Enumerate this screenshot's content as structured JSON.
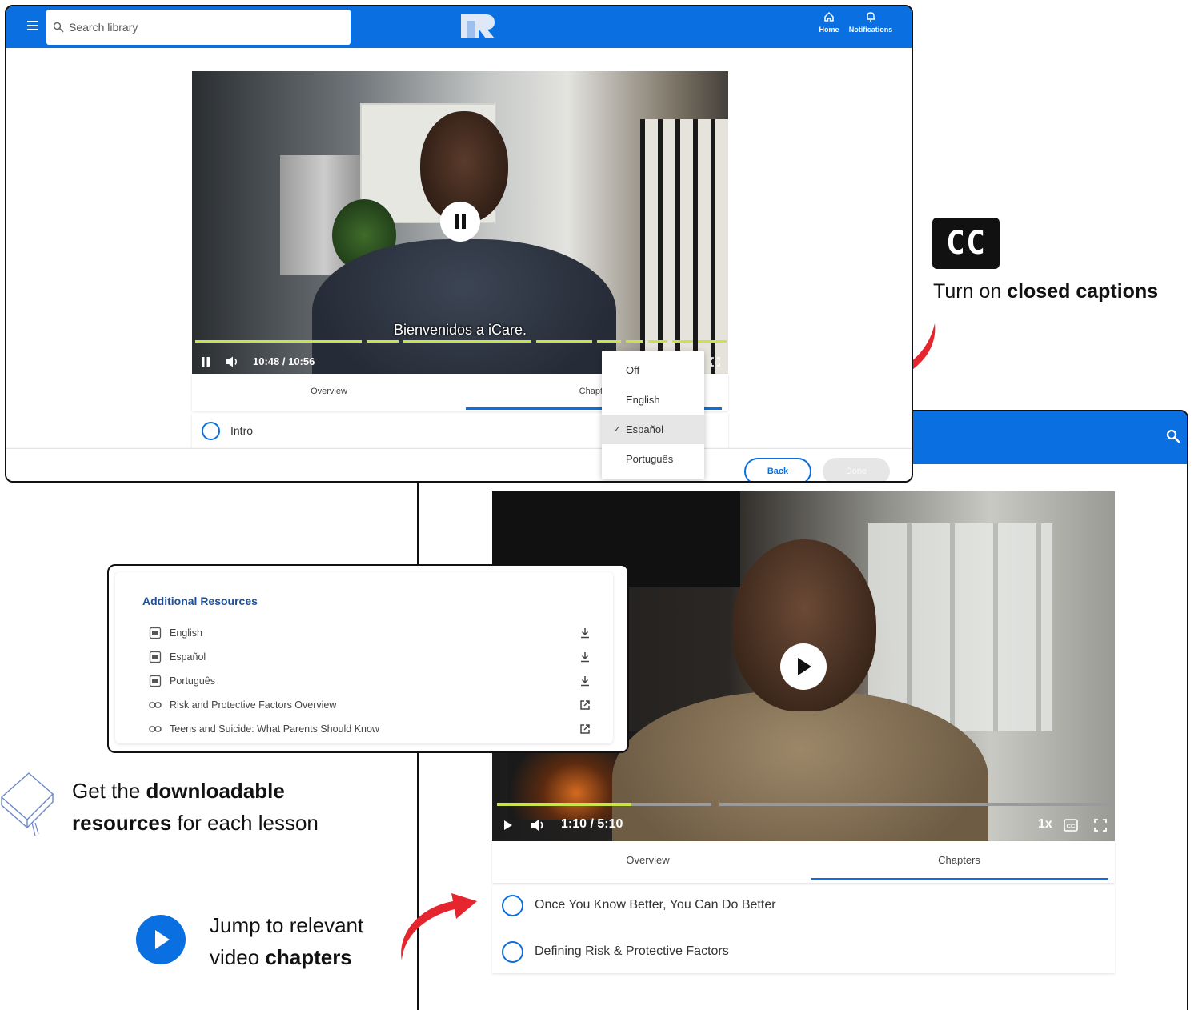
{
  "window1": {
    "search": {
      "placeholder": "Search library"
    },
    "nav": {
      "home_label": "Home",
      "notifications_label": "Notifications"
    },
    "video": {
      "subtitle": "Bienvenidos a iCare.",
      "time": "10:48 / 10:56"
    },
    "tabs": [
      {
        "label": "Overview"
      },
      {
        "label": "Chapters"
      }
    ],
    "captions_menu": {
      "options": [
        {
          "label": "Off"
        },
        {
          "label": "English"
        },
        {
          "label": "Español"
        },
        {
          "label": "Português"
        }
      ],
      "selected": "Español"
    },
    "chapters": [
      {
        "label": "Intro"
      }
    ],
    "footer": {
      "back_label": "Back",
      "done_label": "Done"
    }
  },
  "window2": {
    "video": {
      "time": "1:10 / 5:10",
      "speed": "1x",
      "progress_fraction": 0.23
    },
    "tabs": [
      {
        "label": "Overview"
      },
      {
        "label": "Chapters"
      }
    ],
    "active_tab": "Chapters",
    "chapters": [
      {
        "label": "Once You Know Better, You Can Do Better"
      },
      {
        "label": "Defining Risk & Protective Factors"
      }
    ]
  },
  "resources": {
    "title": "Additional Resources",
    "items": [
      {
        "label": "English",
        "icon": "pdf-icon",
        "action": "download-icon"
      },
      {
        "label": "Español",
        "icon": "pdf-icon",
        "action": "download-icon"
      },
      {
        "label": "Português",
        "icon": "pdf-icon",
        "action": "download-icon"
      },
      {
        "label": "Risk and Protective Factors Overview",
        "icon": "link-icon",
        "action": "external-link-icon"
      },
      {
        "label": "Teens and Suicide: What Parents Should Know",
        "icon": "link-icon",
        "action": "external-link-icon"
      }
    ]
  },
  "annotations": {
    "cc_badge": "CC",
    "cc_note": {
      "before": "Turn on ",
      "bold": "closed captions"
    },
    "resources_note": {
      "before": "Get the ",
      "bold1": "downloadable",
      "bold2": "resources",
      "after": " for each lesson"
    },
    "chapters_note": {
      "line1": "Jump to relevant",
      "before": "video ",
      "bold": "chapters"
    }
  },
  "colors": {
    "brand_blue": "#0a6fe0",
    "progress_green": "#c9e34a",
    "arrow_red": "#e5262e",
    "resources_title": "#1c4f9c"
  }
}
